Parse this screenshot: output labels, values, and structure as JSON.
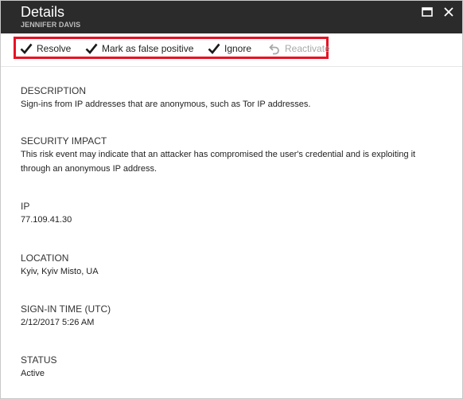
{
  "header": {
    "title": "Details",
    "subtitle": "JENNIFER DAVIS",
    "background": "#2b2b2b"
  },
  "toolbar": {
    "highlight_color": "#e81123",
    "commands": [
      {
        "label": "Resolve",
        "icon": "checkmark-icon",
        "enabled": true
      },
      {
        "label": "Mark as false positive",
        "icon": "checkmark-icon",
        "enabled": true
      },
      {
        "label": "Ignore",
        "icon": "checkmark-icon",
        "enabled": true
      },
      {
        "label": "Reactivate",
        "icon": "undo-icon",
        "enabled": false
      }
    ]
  },
  "details": {
    "description": {
      "label": "DESCRIPTION",
      "value": "Sign-ins from IP addresses that are anonymous, such as Tor IP addresses."
    },
    "security_impact": {
      "label": "SECURITY IMPACT",
      "value": "This risk event may indicate that an attacker has compromised the user's credential and is exploiting it through an anonymous IP address."
    },
    "ip": {
      "label": "IP",
      "value": "77.109.41.30"
    },
    "location": {
      "label": "LOCATION",
      "value": "Kyiv, Kyiv Misto, UA"
    },
    "sign_in_time": {
      "label": "SIGN-IN TIME (UTC)",
      "value": "2/12/2017 5:26 AM"
    },
    "status": {
      "label": "STATUS",
      "value": "Active"
    }
  }
}
